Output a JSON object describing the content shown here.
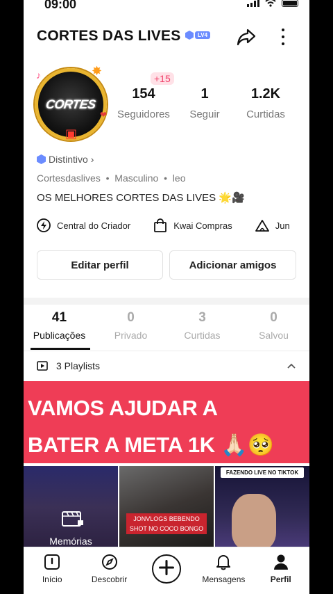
{
  "status_bar": {
    "time": "09:00"
  },
  "header": {
    "title": "CORTES DAS LIVES",
    "level_badge": "LV4"
  },
  "avatar": {
    "text": "CORTES"
  },
  "new_followers_badge": "+15",
  "stats": [
    {
      "value": "154",
      "label": "Seguidores"
    },
    {
      "value": "1",
      "label": "Seguir"
    },
    {
      "value": "1.2K",
      "label": "Curtidas"
    }
  ],
  "profile": {
    "distintivo": "Distintivo",
    "username": "Cortesdaslives",
    "gender": "Masculino",
    "extra": "leo",
    "bio": "OS MELHORES CORTES DAS LIVES 🌟🎥"
  },
  "links": [
    {
      "label": "Central do Criador",
      "icon": "lightning-icon"
    },
    {
      "label": "Kwai Compras",
      "icon": "shopping-bag-icon"
    },
    {
      "label": "Jun",
      "icon": "tent-icon"
    }
  ],
  "buttons": {
    "edit_profile": "Editar perfil",
    "add_friends": "Adicionar amigos"
  },
  "tabs": [
    {
      "count": "41",
      "label": "Publicações",
      "active": true
    },
    {
      "count": "0",
      "label": "Privado",
      "active": false
    },
    {
      "count": "3",
      "label": "Curtidas",
      "active": false
    },
    {
      "count": "0",
      "label": "Salvou",
      "active": false
    }
  ],
  "playlists": "3 Playlists",
  "banner": {
    "line1": "VAMOS AJUDAR A",
    "line2": "BATER A META 1K 🙏🏻🥺"
  },
  "grid": {
    "memories_label": "Memórias",
    "caption_2": "JONVLOGS BEBENDO SHOT NO COCO BONGO",
    "caption_3": "FAZENDO LIVE NO TIKTOK"
  },
  "bottom_nav": [
    {
      "label": "Início",
      "icon": "home-icon"
    },
    {
      "label": "Descobrir",
      "icon": "compass-icon"
    },
    {
      "label": "",
      "icon": "plus-icon"
    },
    {
      "label": "Mensagens",
      "icon": "bell-icon"
    },
    {
      "label": "Perfil",
      "icon": "person-icon"
    }
  ],
  "colors": {
    "accent_red": "#ef3d56",
    "badge_blue": "#6b8cff",
    "avatar_ring": "#e9b530"
  }
}
